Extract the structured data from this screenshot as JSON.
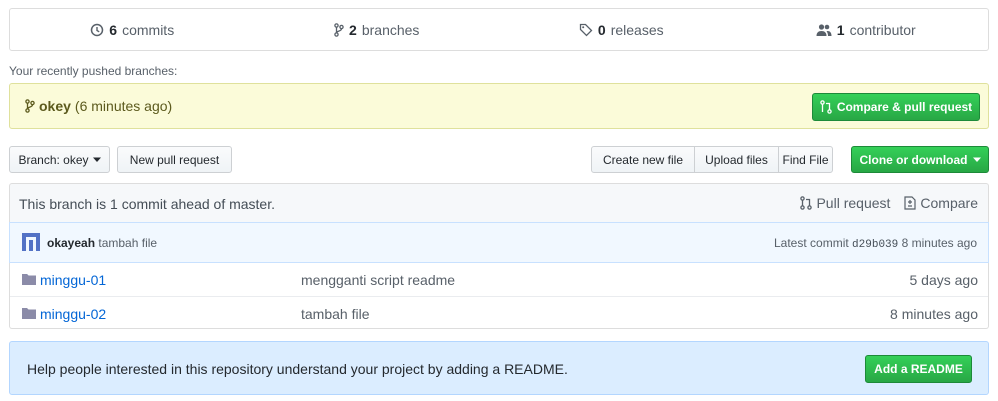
{
  "summary": {
    "commits": {
      "count": "6",
      "label": "commits",
      "icon": "history-icon"
    },
    "branches": {
      "count": "2",
      "label": "branches",
      "icon": "git-branch-icon"
    },
    "releases": {
      "count": "0",
      "label": "releases",
      "icon": "tag-icon"
    },
    "contributors": {
      "count": "1",
      "label": "contributor",
      "icon": "people-icon"
    }
  },
  "recent": {
    "label": "Your recently pushed branches:",
    "branch_name": "okey",
    "time": "(6 minutes ago)",
    "compare_button": "Compare & pull request"
  },
  "toolbar": {
    "branch_label": "Branch: okey",
    "new_pr": "New pull request",
    "create_file": "Create new file",
    "upload_files": "Upload files",
    "find_file": "Find File",
    "clone": "Clone or download"
  },
  "ahead": {
    "text": "This branch is 1 commit ahead of master.",
    "pull_request": "Pull request",
    "compare": "Compare"
  },
  "latest_commit": {
    "author": "okayeah",
    "message": "tambah file",
    "prefix": "Latest commit",
    "sha": "d29b039",
    "time": "8 minutes ago"
  },
  "files": [
    {
      "name": "minggu-01",
      "message": "mengganti script readme",
      "age": "5 days ago"
    },
    {
      "name": "minggu-02",
      "message": "tambah file",
      "age": "8 minutes ago"
    }
  ],
  "readme": {
    "text": "Help people interested in this repository understand your project by adding a README.",
    "button": "Add a README"
  },
  "colors": {
    "accent_green": "#28a745",
    "link_blue": "#0366d6",
    "notice_yellow": "#fbfbd9",
    "readme_blue": "#dbedff"
  }
}
